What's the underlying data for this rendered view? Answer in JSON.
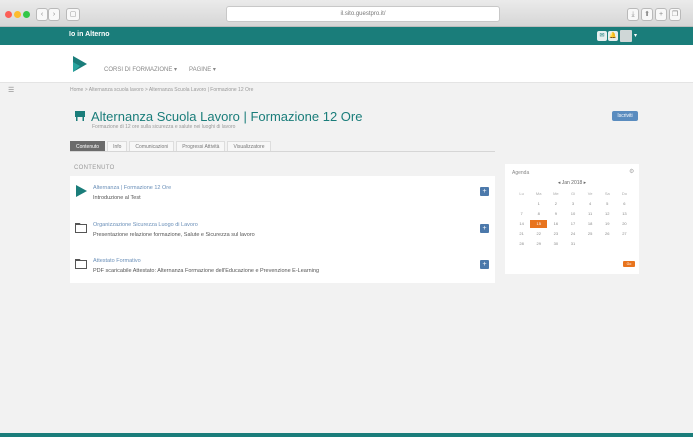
{
  "browser": {
    "address": "il.sito.guestpro.it/",
    "back_label": "‹",
    "forward_label": "›",
    "view_label": "▢",
    "right_buttons": [
      "⤓",
      "⬆",
      "+",
      "❐"
    ]
  },
  "topbar": {
    "site_name": "Io in Alterno",
    "icons": [
      "✉",
      "🔔"
    ],
    "caret": "▾"
  },
  "nav": {
    "items": [
      "CORSI DI FORMAZIONE ▾",
      "PAGINE ▾"
    ]
  },
  "sidebar_toggle": "☰",
  "breadcrumb": "Home > Alternanza scuola lavoro > Alternanza Scuola Lavoro | Formazione 12 Ore",
  "course": {
    "title": "Alternanza Scuola Lavoro | Formazione 12 Ore",
    "subtitle": "Formazione di 12 ore sulla sicurezza e salute nei luoghi di lavoro",
    "join_label": "Iscriviti"
  },
  "tabs": [
    "Contenuto",
    "Info",
    "Comunicazioni",
    "Progressi Attività",
    "Visualizzatore"
  ],
  "section_label": "CONTENUTO",
  "items": [
    {
      "title": "Alternanza | Formazione 12 Ore",
      "desc": "Introduzione al Test"
    },
    {
      "title": "Organizzazione Sicurezza Luogo di Lavoro",
      "desc": "Presentazione relazione formazione, Salute e Sicurezza sul lavoro"
    },
    {
      "title": "Attestato Formativo",
      "desc": "PDF scaricabile Attestato: Alternanza Formazione dell'Educazione e Prevenzione E-Learning"
    }
  ],
  "calendar": {
    "title": "Agenda",
    "month": "◂  Jan 2018  ▸",
    "weekdays": [
      "Lu",
      "Ma",
      "Me",
      "Gi",
      "Ve",
      "Sa",
      "Do"
    ],
    "days": [
      "",
      "1",
      "2",
      "3",
      "4",
      "5",
      "6",
      "7",
      "8",
      "9",
      "10",
      "11",
      "12",
      "13",
      "14",
      "15",
      "16",
      "17",
      "18",
      "19",
      "20",
      "21",
      "22",
      "23",
      "24",
      "25",
      "26",
      "27",
      "28",
      "29",
      "30",
      "31"
    ],
    "today": "15",
    "badge": "Go",
    "gear": "⚙"
  },
  "colors": {
    "accent": "#1a7d7a",
    "link": "#6a8fb8",
    "action": "#4c79ab",
    "today": "#e8741e"
  }
}
